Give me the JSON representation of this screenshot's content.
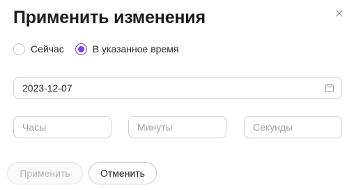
{
  "dialog": {
    "title": "Применить изменения",
    "close_icon": "close-icon"
  },
  "schedule": {
    "options": [
      {
        "label": "Сейчас",
        "selected": false
      },
      {
        "label": "В указанное время",
        "selected": true
      }
    ]
  },
  "date": {
    "value": "2023-12-07",
    "icon": "calendar-icon"
  },
  "time": {
    "hours_placeholder": "Часы",
    "minutes_placeholder": "Минуты",
    "seconds_placeholder": "Секунды"
  },
  "actions": {
    "apply_label": "Применить",
    "apply_disabled": true,
    "cancel_label": "Отменить"
  },
  "colors": {
    "accent": "#7b3ff2",
    "border": "#d0d0d0",
    "placeholder": "#a3a3a3",
    "disabled_text": "#b3b3b3"
  }
}
